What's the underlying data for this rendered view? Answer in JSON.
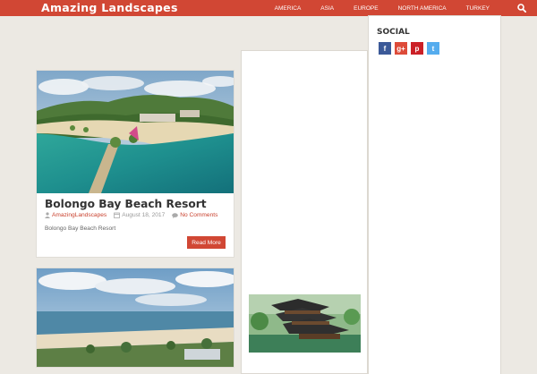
{
  "header": {
    "brand": "Amazing Landscapes",
    "nav": [
      "AMERICA",
      "ASIA",
      "EUROPE",
      "NORTH AMERICA",
      "TURKEY"
    ]
  },
  "posts": [
    {
      "title": "Bolongo Bay Beach Resort",
      "author": "AmazingLandscapes",
      "date": "August 18, 2017",
      "comments": "No Comments",
      "excerpt": "Bolongo Bay Beach Resort",
      "read_more": "Read More"
    }
  ],
  "sidebar": {
    "social_title": "SOCIAL",
    "icons": [
      {
        "label": "f",
        "color": "#3b5998"
      },
      {
        "label": "g+",
        "color": "#dd4b39"
      },
      {
        "label": "p",
        "color": "#cb2027"
      },
      {
        "label": "t",
        "color": "#55acee"
      }
    ]
  },
  "colors": {
    "accent": "#d14734",
    "background": "#ece9e3"
  }
}
